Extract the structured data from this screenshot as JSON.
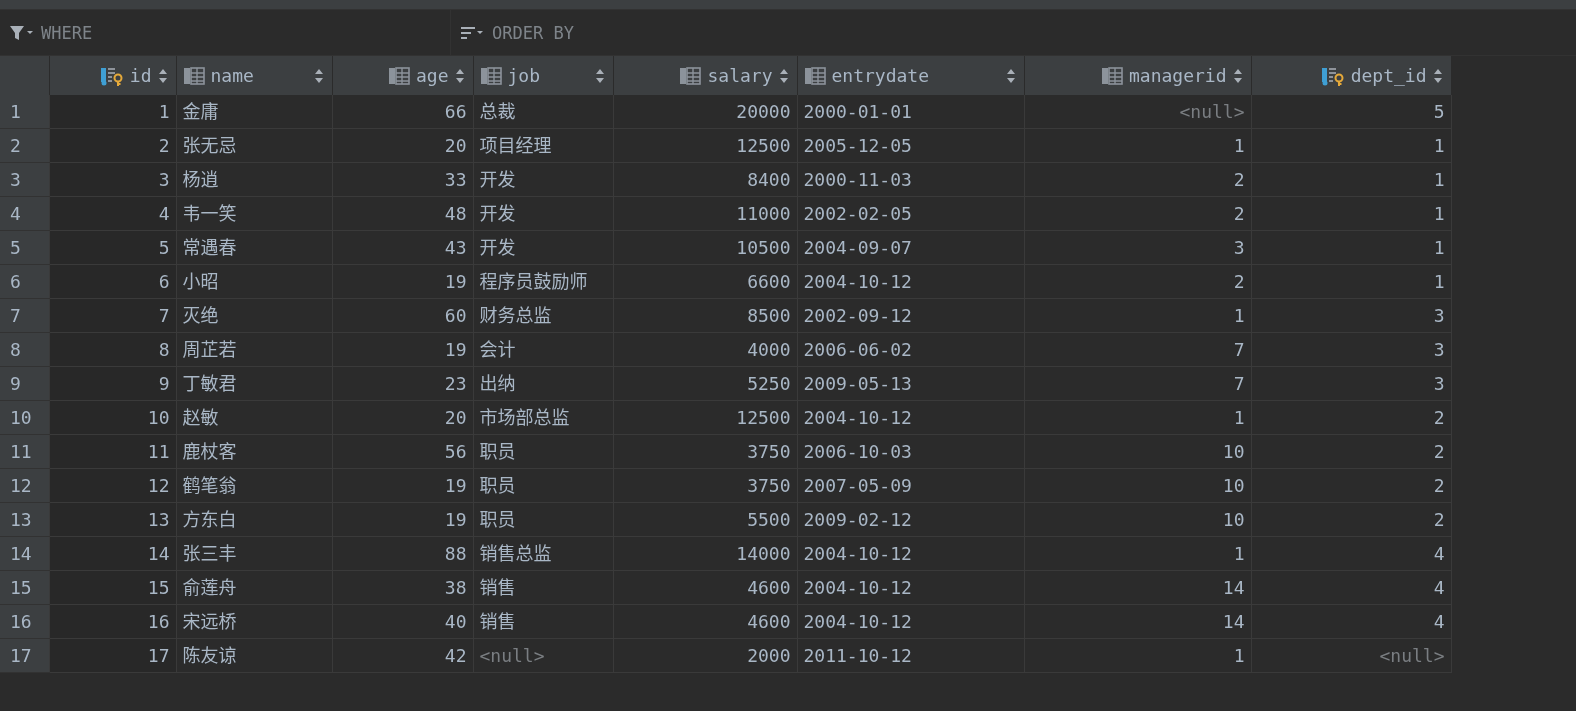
{
  "filter_bar": {
    "where": {
      "placeholder": "WHERE"
    },
    "order_by": {
      "placeholder": "ORDER BY"
    }
  },
  "table": {
    "columns": [
      {
        "label": "id",
        "kind": "key"
      },
      {
        "label": "name",
        "kind": "column"
      },
      {
        "label": "age",
        "kind": "column"
      },
      {
        "label": "job",
        "kind": "column"
      },
      {
        "label": "salary",
        "kind": "column"
      },
      {
        "label": "entrydate",
        "kind": "column"
      },
      {
        "label": "managerid",
        "kind": "column"
      },
      {
        "label": "dept_id",
        "kind": "key"
      }
    ],
    "rows": [
      {
        "number": "1",
        "cells": [
          "1",
          "金庸",
          "66",
          "总裁",
          "20000",
          "2000-01-01",
          {
            "text": "<null>",
            "kind": "null"
          },
          "5"
        ]
      },
      {
        "number": "2",
        "cells": [
          "2",
          "张无忌",
          "20",
          "项目经理",
          "12500",
          "2005-12-05",
          "1",
          "1"
        ]
      },
      {
        "number": "3",
        "cells": [
          "3",
          "杨逍",
          "33",
          "开发",
          "8400",
          "2000-11-03",
          "2",
          "1"
        ]
      },
      {
        "number": "4",
        "cells": [
          "4",
          "韦一笑",
          "48",
          "开发",
          "11000",
          "2002-02-05",
          "2",
          "1"
        ]
      },
      {
        "number": "5",
        "cells": [
          "5",
          "常遇春",
          "43",
          "开发",
          "10500",
          "2004-09-07",
          "3",
          "1"
        ]
      },
      {
        "number": "6",
        "cells": [
          "6",
          "小昭",
          "19",
          "程序员鼓励师",
          "6600",
          "2004-10-12",
          "2",
          "1"
        ]
      },
      {
        "number": "7",
        "cells": [
          "7",
          "灭绝",
          "60",
          "财务总监",
          "8500",
          "2002-09-12",
          "1",
          "3"
        ]
      },
      {
        "number": "8",
        "cells": [
          "8",
          "周芷若",
          "19",
          "会计",
          "4000",
          "2006-06-02",
          "7",
          "3"
        ]
      },
      {
        "number": "9",
        "cells": [
          "9",
          "丁敏君",
          "23",
          "出纳",
          "5250",
          "2009-05-13",
          "7",
          "3"
        ]
      },
      {
        "number": "10",
        "cells": [
          "10",
          "赵敏",
          "20",
          "市场部总监",
          "12500",
          "2004-10-12",
          "1",
          "2"
        ]
      },
      {
        "number": "11",
        "cells": [
          "11",
          "鹿杖客",
          "56",
          "职员",
          "3750",
          "2006-10-03",
          "10",
          "2"
        ]
      },
      {
        "number": "12",
        "cells": [
          "12",
          "鹤笔翁",
          "19",
          "职员",
          "3750",
          "2007-05-09",
          "10",
          "2"
        ]
      },
      {
        "number": "13",
        "cells": [
          "13",
          "方东白",
          "19",
          "职员",
          "5500",
          "2009-02-12",
          "10",
          "2"
        ]
      },
      {
        "number": "14",
        "cells": [
          "14",
          "张三丰",
          "88",
          "销售总监",
          "14000",
          "2004-10-12",
          "1",
          "4"
        ]
      },
      {
        "number": "15",
        "cells": [
          "15",
          "俞莲舟",
          "38",
          "销售",
          "4600",
          "2004-10-12",
          "14",
          "4"
        ]
      },
      {
        "number": "16",
        "cells": [
          "16",
          "宋远桥",
          "40",
          "销售",
          "4600",
          "2004-10-12",
          "14",
          "4"
        ]
      },
      {
        "number": "17",
        "cells": [
          "17",
          "陈友谅",
          "42",
          {
            "text": "<null>",
            "kind": "null"
          },
          "2000",
          "2011-10-12",
          "1",
          {
            "text": "<null>",
            "kind": "null"
          }
        ]
      }
    ]
  }
}
